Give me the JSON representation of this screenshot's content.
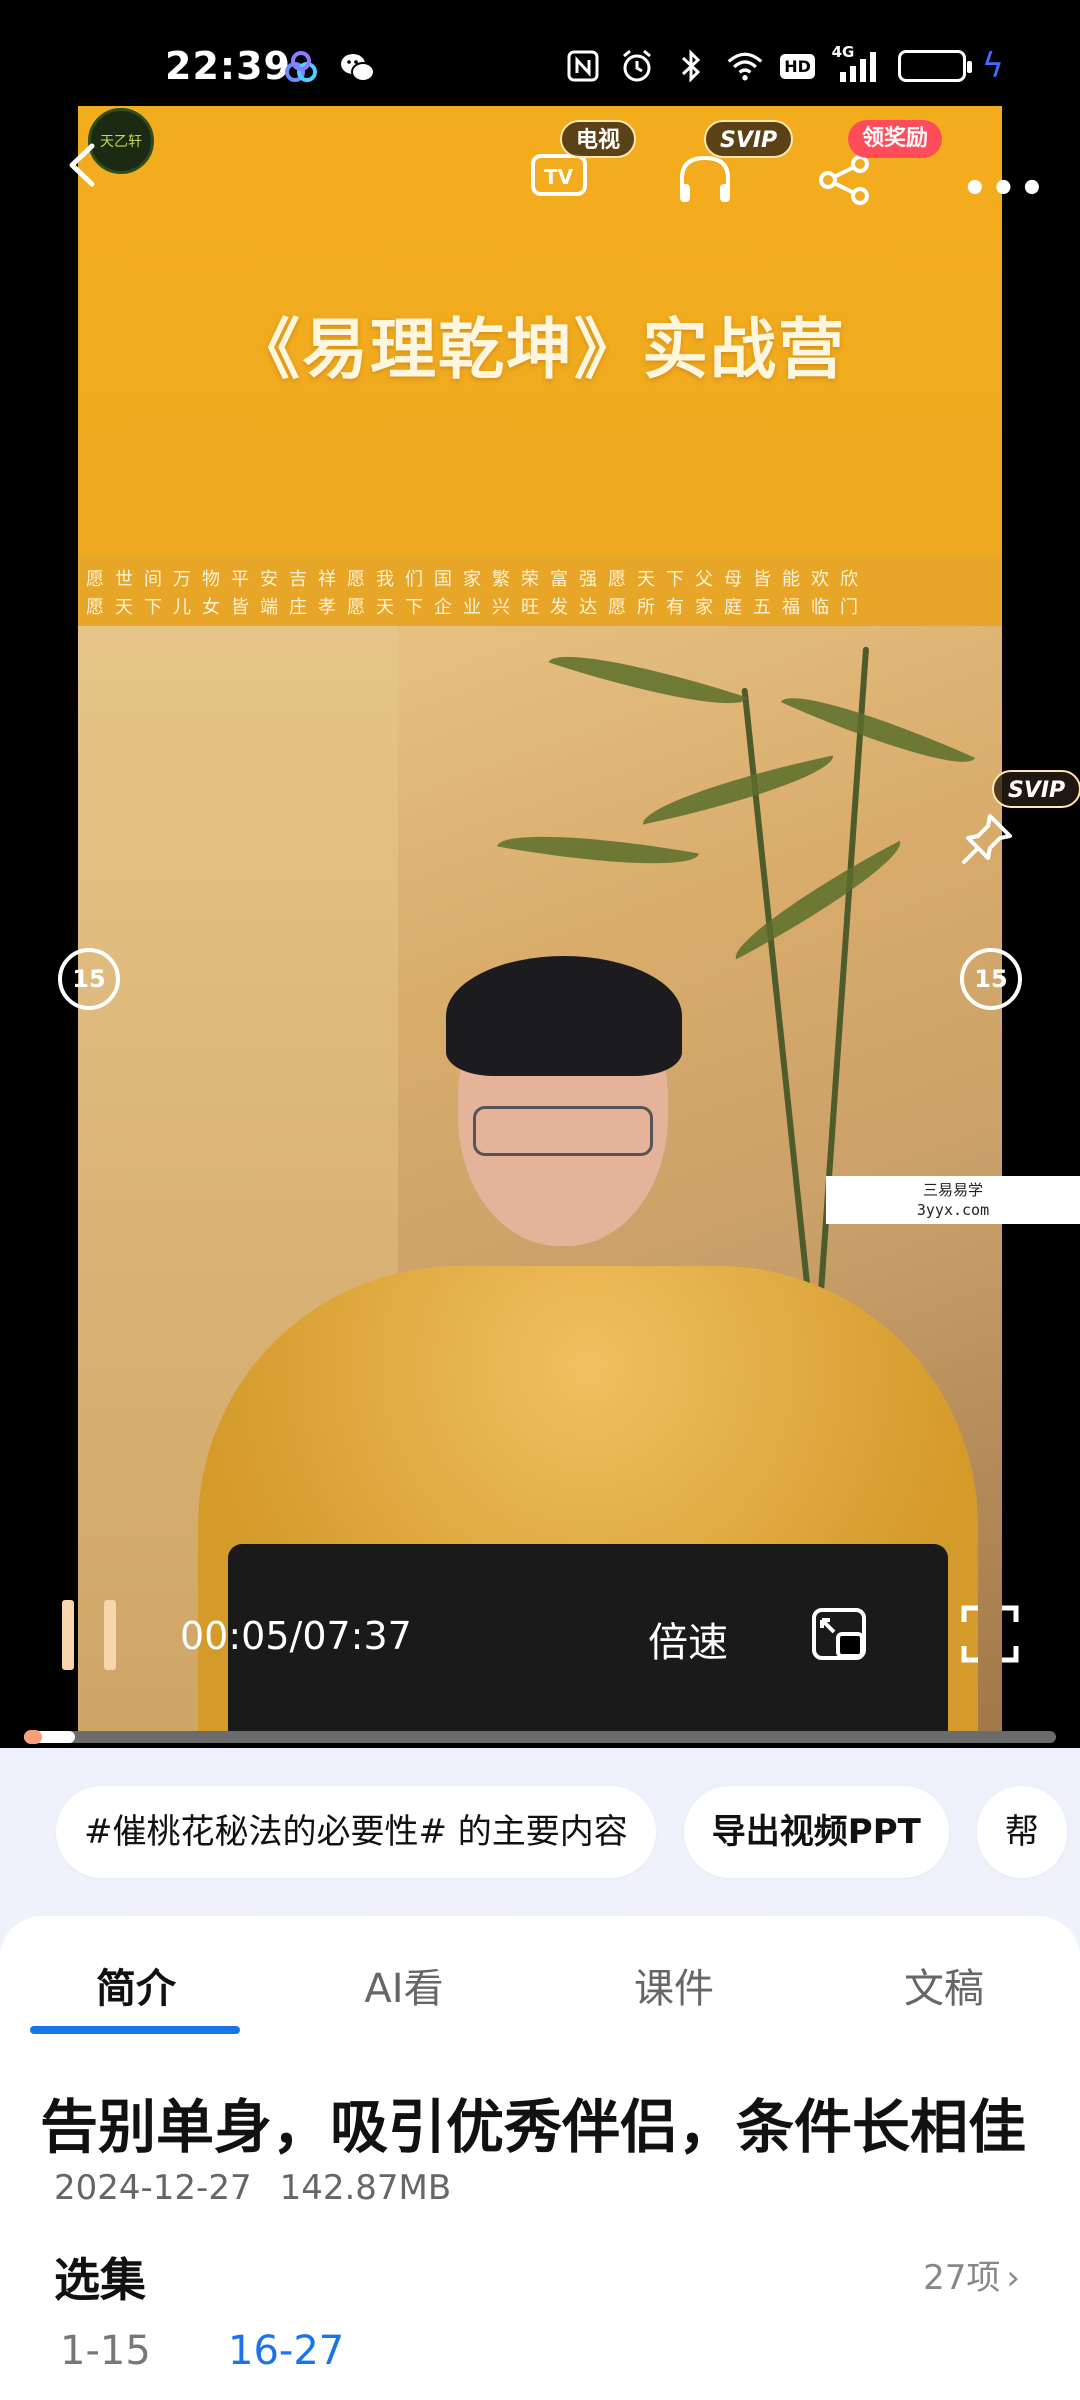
{
  "status_bar": {
    "time": "22:39",
    "left_icons": [
      "baidu-netdisk-icon",
      "wechat-icon"
    ],
    "right_icons": [
      "nfc-icon",
      "alarm-icon",
      "bluetooth-icon",
      "wifi-icon",
      "hd-icon",
      "signal-4g-icon",
      "battery-icon",
      "charging-icon"
    ],
    "network_label": "4G",
    "hd_label": "HD"
  },
  "video": {
    "banner_title": "《易理乾坤》实战营",
    "banner_strip_line1": "愿世间万物平安吉祥愿我们国家繁荣富强愿天下父母皆能欢欣",
    "banner_strip_line2": "愿天下儿女皆端庄孝愿天下企业兴旺发达愿所有家庭五福临门",
    "watermark_line1": "三易易学",
    "watermark_line2": "3yyx.com",
    "logo_text": "天乙轩",
    "badges": {
      "tv": "电视",
      "svip": "SVIP",
      "reward": "领奖励",
      "pin_svip": "SVIP"
    },
    "rewind_label": "15",
    "forward_label": "15",
    "current_time": "00:05",
    "separator": "/",
    "duration": "07:37",
    "speed_label": "倍速",
    "progress_fraction": 0.011
  },
  "chips": [
    "#催桃花秘法的必要性# 的主要内容",
    "导出视频PPT",
    "帮"
  ],
  "tabs": [
    {
      "label": "简介",
      "active": true
    },
    {
      "label": "AI看",
      "active": false
    },
    {
      "label": "课件",
      "active": false
    },
    {
      "label": "文稿",
      "active": false
    }
  ],
  "detail": {
    "title": "告别单身，吸引优秀伴侣，条件长相佳",
    "date": "2024-12-27",
    "size": "142.87MB",
    "episodes_label": "选集",
    "episodes_count": "27项",
    "ranges": [
      "1-15",
      "16-27"
    ]
  },
  "colors": {
    "accent": "#1a73e8",
    "banner": "#f2ac1e",
    "reward_badge": "#ff4c5a",
    "battery": "#3f6bff"
  }
}
